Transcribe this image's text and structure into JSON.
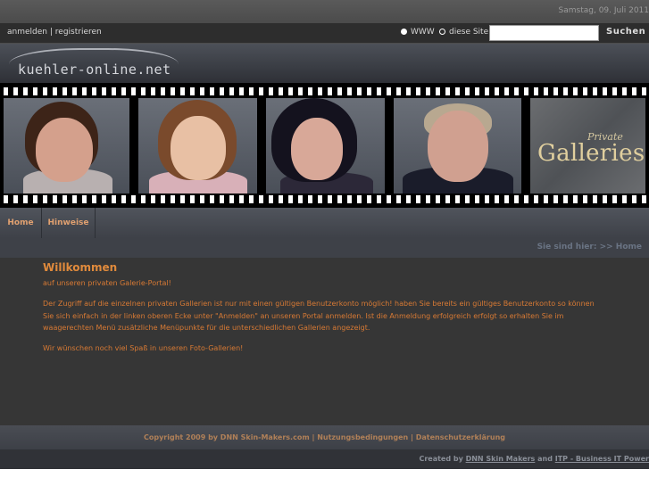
{
  "header": {
    "date": "Samstag, 09. Juli 2011",
    "login_link": "anmelden",
    "separator": "|",
    "register_link": "registrieren",
    "search_options": [
      "WWW",
      "diese Site"
    ],
    "search_button": "Suchen",
    "search_value": ""
  },
  "logo": {
    "text": "kuehler-online.net"
  },
  "banner": {
    "private_label": "Private",
    "galleries_label": "Galleries"
  },
  "nav": {
    "items": [
      "Home",
      "Hinweise"
    ]
  },
  "breadcrumb": {
    "label": "Sie sind hier: >> Home"
  },
  "content": {
    "title": "Willkommen",
    "subtitle": "auf unseren privaten Galerie-Portal!",
    "paragraph_lines": [
      "Der Zugriff auf die einzelnen privaten Gallerien ist nur mit einen gültigen Benutzerkonto möglich! haben Sie bereits ein gültiges Benutzerkonto so können",
      "Sie sich einfach in der linken oberen Ecke unter \"Anmelden\" an unseren Portal anmelden. Ist die Anmeldung erfolgreich erfolgt so erhalten Sie im",
      "waagerechten Menü zusätzliche Menüpunkte für die unterschiedlichen Gallerien angezeigt."
    ],
    "closing": "Wir wünschen noch viel Spaß in unseren Foto-Gallerien!"
  },
  "footer": {
    "copyright": "Copyright 2009 by DNN Skin-Makers.com",
    "sep": "|",
    "terms": "Nutzungsbedingungen",
    "privacy": "Datenschutzerklärung"
  },
  "credits": {
    "prefix": "Created by",
    "link1": "DNN Skin Makers",
    "and": "and",
    "link2": "ITP - Business IT Power"
  },
  "colors": {
    "accent": "#e08a3c",
    "content_text": "#d87a34",
    "nav_text": "#e0a070"
  },
  "icons": [
    "radio-selected-icon",
    "radio-unselected-icon"
  ]
}
